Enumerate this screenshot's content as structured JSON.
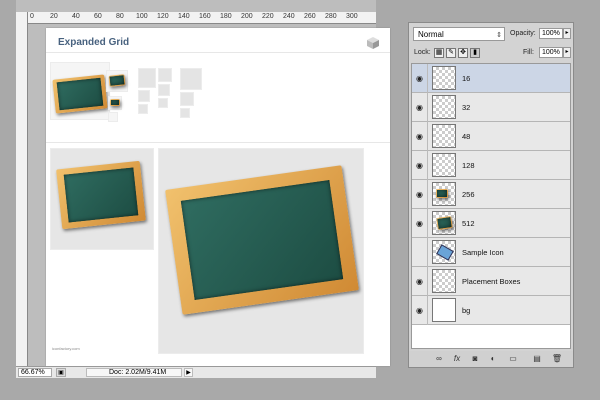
{
  "document": {
    "title": "Expanded Grid",
    "ruler_ticks": [
      "0",
      "20",
      "40",
      "60",
      "80",
      "100",
      "120",
      "140",
      "160",
      "180",
      "200",
      "220",
      "240",
      "260",
      "280",
      "300"
    ],
    "footer_credit": "iconfactory.com"
  },
  "status_bar": {
    "zoom": "66.67%",
    "doc_size": "Doc: 2.02M/9.41M"
  },
  "layers_panel": {
    "blend_mode": "Normal",
    "opacity_label": "Opacity:",
    "opacity_value": "100%",
    "lock_label": "Lock:",
    "fill_label": "Fill:",
    "fill_value": "100%",
    "layers": [
      {
        "name": "16",
        "visible": true,
        "selected": true
      },
      {
        "name": "32",
        "visible": true,
        "selected": false
      },
      {
        "name": "48",
        "visible": true,
        "selected": false
      },
      {
        "name": "128",
        "visible": true,
        "selected": false
      },
      {
        "name": "256",
        "visible": true,
        "selected": false
      },
      {
        "name": "512",
        "visible": true,
        "selected": false
      },
      {
        "name": "Sample Icon",
        "visible": false,
        "selected": false
      },
      {
        "name": "Placement Boxes",
        "visible": true,
        "selected": false
      },
      {
        "name": "bg",
        "visible": true,
        "selected": false
      }
    ]
  },
  "colors": {
    "accent_title": "#48627f",
    "selected_layer": "#ccd6e6",
    "chalkboard": "#2f6c60",
    "frame": "#e0a24e"
  }
}
